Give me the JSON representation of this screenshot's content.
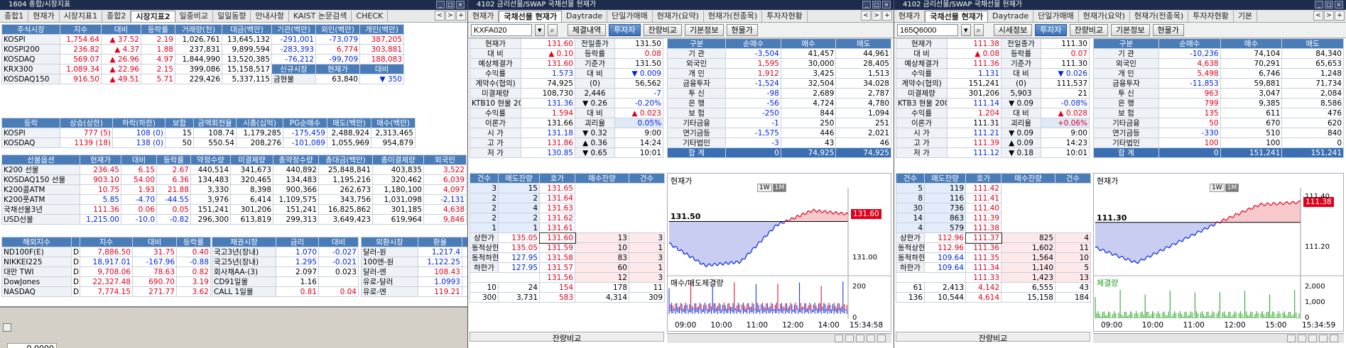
{
  "w1": {
    "title": "1604 종합/시장지표",
    "tabs": [
      "종합1",
      "현재가",
      "시장지표1",
      "종합2",
      "시장지표2",
      "일중비교",
      "일일동향",
      "안내사항",
      "KAIST 논문검색",
      "CHECK"
    ],
    "active": 4,
    "stock_hdr": [
      "주식시장",
      "지수",
      "대비",
      "등락률",
      "거래량(천)",
      "대금(백만)",
      "기관(백만)",
      "외인(백만)",
      "개인(백만)"
    ],
    "stock_rows": [
      {
        "n": "KOSPI",
        "v": [
          "1,754.64",
          "▲ 37.52",
          "2.19",
          "1,026,761",
          "13,645,132",
          "-291,001",
          "-73,079",
          "387,205"
        ],
        "c": [
          "r",
          "r",
          "r",
          "",
          "",
          "b",
          "b",
          "r"
        ]
      },
      {
        "n": "KOSPI200",
        "v": [
          "236.82",
          "▲ 4.37",
          "1.88",
          "237,831",
          "9,899,594",
          "-283,393",
          "6,774",
          "303,881"
        ],
        "c": [
          "r",
          "r",
          "r",
          "",
          "",
          "b",
          "r",
          "r"
        ]
      },
      {
        "n": "KOSDAQ",
        "v": [
          "569.07",
          "▲ 26.96",
          "4.97",
          "1,844,990",
          "13,520,385",
          "-76,212",
          "-99,709",
          "188,083"
        ],
        "c": [
          "r",
          "r",
          "r",
          "",
          "",
          "b",
          "b",
          "r"
        ]
      },
      {
        "n": "KRX300",
        "v": [
          "1,089.34",
          "▲ 22.96",
          "2.15",
          "399,086",
          "15,158,517",
          "신규시장",
          "현재가",
          "대비"
        ],
        "c": [
          "r",
          "r",
          "r",
          "",
          "",
          "h",
          "h",
          "h"
        ]
      },
      {
        "n": "KOSDAQ150",
        "v": [
          "916.50",
          "▲ 49.51",
          "5.71",
          "229,426",
          "5,337,115",
          "금현물",
          "63,840",
          "▼ 350"
        ],
        "c": [
          "r",
          "r",
          "r",
          "",
          "",
          "l",
          "",
          "b"
        ]
      }
    ],
    "adv_hdr": [
      "등락",
      "상승(상한)",
      "하락(하한)",
      "보합",
      "금액회전율",
      "시총(십억)",
      "PG순매수",
      "매도(백만)",
      "매수(백만)"
    ],
    "adv_rows": [
      {
        "n": "KOSPI",
        "v": [
          "777 (5)",
          "108 (0)",
          "15",
          "108.74",
          "1,179,285",
          "-175,459",
          "2,488,924",
          "2,313,465"
        ],
        "c": [
          "r",
          "b",
          "",
          "",
          "",
          "b",
          "",
          ""
        ]
      },
      {
        "n": "KOSDAQ",
        "v": [
          "1139 (18)",
          "138 (0)",
          "50",
          "550.54",
          "208,276",
          "-101,089",
          "1,055,969",
          "954,879"
        ],
        "c": [
          "r",
          "b",
          "",
          "",
          "",
          "b",
          "",
          ""
        ]
      }
    ],
    "fut_hdr": [
      "선물옵션",
      "현재가",
      "대비",
      "등락률",
      "약정수량",
      "미결제량",
      "총약정수량",
      "총대금(백만)",
      "총미결제량",
      "외국인"
    ],
    "fut_rows": [
      {
        "n": "K200 선물",
        "v": [
          "236.45",
          "6.15",
          "2.67",
          "440,514",
          "341,673",
          "440,892",
          "25,848,841",
          "403,835",
          "3,522"
        ],
        "c": [
          "r",
          "r",
          "r",
          "",
          "",
          "",
          "",
          "",
          "r"
        ]
      },
      {
        "n": "KOSDAQ150 선물",
        "v": [
          "903.10",
          "54.00",
          "6.36",
          "134,483",
          "320,465",
          "134,483",
          "1,195,216",
          "320,462",
          "6,039"
        ],
        "c": [
          "r",
          "r",
          "r",
          "",
          "",
          "",
          "",
          "",
          "r"
        ]
      },
      {
        "n": "K200콜ATM",
        "v": [
          "10.75",
          "1.93",
          "21.88",
          "3,330",
          "8,398",
          "900,366",
          "262,673",
          "1,180,100",
          "4,097"
        ],
        "c": [
          "r",
          "r",
          "r",
          "",
          "",
          "",
          "",
          "",
          "r"
        ]
      },
      {
        "n": "K200풋ATM",
        "v": [
          "5.85",
          "-4.70",
          "-44.55",
          "3,976",
          "6,414",
          "1,109,575",
          "343,756",
          "1,031,098",
          "-2,131"
        ],
        "c": [
          "b",
          "b",
          "b",
          "",
          "",
          "",
          "",
          "",
          "b"
        ]
      },
      {
        "n": "국채선물3년",
        "v": [
          "111.36",
          "0.06",
          "0.05",
          "151,241",
          "301,206",
          "151,241",
          "16,825,862",
          "301,185",
          "4,638"
        ],
        "c": [
          "r",
          "r",
          "r",
          "",
          "",
          "",
          "",
          "",
          "r"
        ]
      },
      {
        "n": "USD선물",
        "v": [
          "1,215.00",
          "-10.0",
          "-0.82",
          "296,300",
          "613,819",
          "299,313",
          "3,649,423",
          "619,964",
          "9,846"
        ],
        "c": [
          "b",
          "b",
          "b",
          "",
          "",
          "",
          "",
          "",
          "r"
        ]
      }
    ],
    "ovs_hdr": [
      "해외지수",
      "",
      "지수",
      "대비",
      "등락률"
    ],
    "ovs_rows": [
      {
        "n": "ND100F(E)",
        "d": "D",
        "v": [
          "7,886.50",
          "31.75",
          "0.40"
        ],
        "c": [
          "r",
          "r",
          "r"
        ]
      },
      {
        "n": "NIKKEI225",
        "d": "D",
        "v": [
          "18,917.01",
          "-167.96",
          "-0.88"
        ],
        "c": [
          "b",
          "b",
          "b"
        ]
      },
      {
        "n": "대만 TWI",
        "d": "D",
        "v": [
          "9,708.06",
          "78.63",
          "0.82"
        ],
        "c": [
          "r",
          "r",
          "r"
        ]
      },
      {
        "n": "DowJones",
        "d": "D",
        "v": [
          "22,327.48",
          "690.70",
          "3.19"
        ],
        "c": [
          "r",
          "r",
          "r"
        ]
      },
      {
        "n": "NASDAQ",
        "d": "D",
        "v": [
          "7,774.15",
          "271.77",
          "3.62"
        ],
        "c": [
          "r",
          "r",
          "r"
        ]
      }
    ],
    "bond_hdr": [
      "채권시장",
      "금리",
      "대비"
    ],
    "bond_rows": [
      {
        "n": "국고3년(장내)",
        "v": [
          "1.070",
          "-0.027"
        ],
        "c": [
          "b",
          "b"
        ]
      },
      {
        "n": "국고5년(장내)",
        "v": [
          "1.295",
          "-0.021"
        ],
        "c": [
          "b",
          "b"
        ]
      },
      {
        "n": "회사채AA-(3)",
        "v": [
          "2.097",
          "0.023"
        ],
        "c": [
          "",
          ""
        ]
      },
      {
        "n": "CD91일물",
        "v": [
          "1.16",
          ""
        ],
        "c": [
          "",
          ""
        ]
      },
      {
        "n": "CALL 1일물",
        "v": [
          "0.81",
          "0.04"
        ],
        "c": [
          "r",
          "r"
        ]
      }
    ],
    "fx_hdr": [
      "외환시장",
      "환율",
      "대비"
    ],
    "fx_rows": [
      {
        "n": "달러-원",
        "v": [
          "1,217.4",
          "-7.0"
        ],
        "c": [
          "b",
          "b"
        ]
      },
      {
        "n": "100엔-원",
        "v": [
          "1,122.25",
          "-12.29"
        ],
        "c": [
          "b",
          "b"
        ]
      },
      {
        "n": "달러-엔",
        "v": [
          "108.43",
          "0.52"
        ],
        "c": [
          "r",
          "r"
        ]
      },
      {
        "n": "유로-달러",
        "v": [
          "1.0993",
          "-0.0047"
        ],
        "c": [
          "b",
          "b"
        ]
      },
      {
        "n": "유로-엔",
        "v": [
          "119.21",
          "0.08"
        ],
        "c": [
          "r",
          "r"
        ]
      }
    ],
    "below_value": "0.0000"
  },
  "panels": [
    {
      "title": "4102 금리선물/SWAP 국채선물 현재가",
      "tabs": [
        "현재가",
        "국채선물 현재가",
        "Daytrade",
        "단일가매매",
        "현재가(요약)",
        "현재가(전종목)",
        "투자자현황"
      ],
      "active": 1,
      "code": "KXFA020",
      "buttons": [
        "체결내역",
        "투자자",
        "잔량비교",
        "기본정보",
        "현물가"
      ],
      "btn_on": 1,
      "info": [
        [
          "현재가",
          "131.60",
          "r",
          "전일종가",
          "131.50",
          ""
        ],
        [
          "대 비",
          "▲ 0.10",
          "r",
          "등락률",
          "0.08",
          "r"
        ],
        [
          "예상체결가",
          "131.60",
          "r",
          "기준가",
          "131.50",
          ""
        ],
        [
          "수익률",
          "1.573",
          "b",
          "대 비",
          "▼ 0.009",
          "b"
        ],
        [
          "계약수(협의)",
          "74,925",
          "",
          "(0)",
          "56,562",
          ""
        ],
        [
          "미결제량",
          "108,730",
          "",
          "2,446",
          "-7",
          "b"
        ],
        [
          "KTB10 현물 20",
          "131.36",
          "b",
          "▼ 0.26",
          "-0.20%",
          "b"
        ],
        [
          "수익률",
          "1.594",
          "r",
          "대 비",
          "▲ 0.023",
          "r"
        ],
        [
          "이론가",
          "131.66",
          "",
          "괴리율",
          "0.05%",
          "b"
        ],
        [
          "시 가",
          "131.18",
          "b",
          "▼ 0.32",
          "9:00",
          ""
        ],
        [
          "고 가",
          "131.86",
          "r",
          "▲ 0.36",
          "14:24",
          ""
        ],
        [
          "저 가",
          "130.85",
          "b",
          "▼ 0.65",
          "10:01",
          ""
        ]
      ],
      "inv_hdr": [
        "구분",
        "순매수",
        "매수",
        "매도"
      ],
      "inv": [
        [
          "기 관",
          "-3,504",
          "41,457",
          "44,961"
        ],
        [
          "외국인",
          "1,595",
          "30,000",
          "28,405"
        ],
        [
          "개 인",
          "1,912",
          "3,425",
          "1,513"
        ],
        [
          "금융투자",
          "-1,524",
          "32,504",
          "34,028"
        ],
        [
          "투 신",
          "-98",
          "2,689",
          "2,787"
        ],
        [
          "은 행",
          "-56",
          "4,724",
          "4,780"
        ],
        [
          "보 험",
          "-250",
          "844",
          "1,094"
        ],
        [
          "기타금융",
          "-1",
          "250",
          "251"
        ],
        [
          "연기금등",
          "-1,575",
          "446",
          "2,021"
        ],
        [
          "기타법인",
          "-3",
          "43",
          "46"
        ],
        [
          "합 계",
          "0",
          "74,925",
          "74,925"
        ]
      ],
      "ob_hdr": [
        "건수",
        "매도잔량",
        "호가",
        "매수잔량",
        "건수"
      ],
      "asks": [
        [
          "3",
          "15",
          "131.65"
        ],
        [
          "2",
          "2",
          "131.64"
        ],
        [
          "2",
          "4",
          "131.63"
        ],
        [
          "2",
          "2",
          "131.62"
        ],
        [
          "1",
          "1",
          "131.61"
        ]
      ],
      "bids": [
        [
          "131.60",
          "13",
          "3"
        ],
        [
          "131.59",
          "10",
          "1"
        ],
        [
          "131.58",
          "83",
          "3"
        ],
        [
          "131.57",
          "60",
          "1"
        ],
        [
          "131.56",
          "12",
          "3"
        ]
      ],
      "limits": [
        [
          "상한가",
          "135.05"
        ],
        [
          "동적상한",
          "135.05"
        ],
        [
          "동적하한",
          "127.95"
        ],
        [
          "하한가",
          "127.95"
        ]
      ],
      "ob_tot1": [
        "10",
        "24",
        "154",
        "178",
        "11"
      ],
      "ob_tot2": [
        "300",
        "3,731",
        "583",
        "4,314",
        "309"
      ],
      "ob_footer": "잔량비교",
      "chart_title": "현재가",
      "ref_label": "131.50",
      "cur_tag": "131.60",
      "y_ticks": [
        "131.00"
      ],
      "vol_title": "매수/매도체결량",
      "vol_ticks": [
        "200",
        "0"
      ],
      "x_ticks": [
        "09:00",
        "10:00",
        "11:00",
        "12:00",
        "14:00"
      ],
      "clock": "15:34:58",
      "chart_btn1": "1W",
      "chart_btn2": "1M",
      "chart_data": {
        "type": "line",
        "title": "현재가",
        "x": [
          "09:00",
          "10:00",
          "11:00",
          "12:00",
          "14:00",
          "15:34"
        ],
        "series": [
          {
            "name": "현재가",
            "values": [
              131.2,
              130.9,
              130.95,
              131.45,
              131.65,
              131.6
            ]
          }
        ],
        "reference": 131.5,
        "ylim": [
          130.8,
          131.9
        ]
      }
    },
    {
      "title": "4102 금리선물/SWAP 국채선물 현재가",
      "tabs": [
        "현재가",
        "국채선물 현재가",
        "Daytrade",
        "단일가매매",
        "현재가(요약)",
        "현재가(전종목)",
        "투자자현황",
        "기본"
      ],
      "active": 1,
      "code": "165Q6000",
      "buttons": [
        "시세정보",
        "투자자",
        "잔량비교",
        "기본정보",
        "현물가"
      ],
      "btn_on": 1,
      "info": [
        [
          "현재가",
          "111.38",
          "r",
          "전일종가",
          "111.30",
          ""
        ],
        [
          "대 비",
          "▲ 0.08",
          "r",
          "등락률",
          "0.07",
          "r"
        ],
        [
          "예상체결가",
          "111.36",
          "r",
          "기준가",
          "111.30",
          ""
        ],
        [
          "수익률",
          "1.131",
          "b",
          "대 비",
          "▼ 0.026",
          "b"
        ],
        [
          "계약수(협의)",
          "151,241",
          "",
          "(0)",
          "111,537",
          ""
        ],
        [
          "미결제량",
          "301,206",
          "",
          "5,903",
          "21",
          ""
        ],
        [
          "KTB3 현물 200",
          "111.14",
          "b",
          "▼ 0.09",
          "-0.08%",
          "b"
        ],
        [
          "수익률",
          "1.204",
          "r",
          "대 비",
          "▲ 0.028",
          "r"
        ],
        [
          "이론가",
          "111.31",
          "",
          "괴리율",
          "+0.06%",
          "r"
        ],
        [
          "시 가",
          "111.21",
          "b",
          "▼ 0.09",
          "9:00",
          ""
        ],
        [
          "고 가",
          "111.39",
          "r",
          "▲ 0.09",
          "14:23",
          ""
        ],
        [
          "저 가",
          "111.12",
          "b",
          "▼ 0.18",
          "10:01",
          ""
        ]
      ],
      "inv_hdr": [
        "구분",
        "순매수",
        "매수",
        "매도"
      ],
      "inv": [
        [
          "기 관",
          "-10,236",
          "74,104",
          "84,340"
        ],
        [
          "외국인",
          "4,638",
          "70,291",
          "65,653"
        ],
        [
          "개 인",
          "5,498",
          "6,746",
          "1,248"
        ],
        [
          "금융투자",
          "-11,853",
          "59,881",
          "71,734"
        ],
        [
          "투 신",
          "963",
          "3,047",
          "2,084"
        ],
        [
          "은 행",
          "799",
          "9,385",
          "8,586"
        ],
        [
          "보 험",
          "135",
          "611",
          "476"
        ],
        [
          "기타금융",
          "50",
          "670",
          "620"
        ],
        [
          "연기금등",
          "-330",
          "510",
          "840"
        ],
        [
          "기타법인",
          "100",
          "100",
          "0"
        ],
        [
          "합 계",
          "0",
          "151,241",
          "151,241"
        ]
      ],
      "ob_hdr": [
        "건수",
        "매도잔량",
        "호가",
        "매수잔량",
        "건수"
      ],
      "asks": [
        [
          "5",
          "119",
          "111.42"
        ],
        [
          "8",
          "116",
          "111.41"
        ],
        [
          "30",
          "736",
          "111.40"
        ],
        [
          "14",
          "863",
          "111.39"
        ],
        [
          "4",
          "579",
          "111.38"
        ]
      ],
      "bids": [
        [
          "111.37",
          "825",
          "4"
        ],
        [
          "111.36",
          "1,602",
          "11"
        ],
        [
          "111.35",
          "1,564",
          "10"
        ],
        [
          "111.34",
          "1,140",
          "5"
        ],
        [
          "111.33",
          "1,423",
          "13"
        ]
      ],
      "limits": [
        [
          "상한가",
          "112.96"
        ],
        [
          "동적상한",
          "112.96"
        ],
        [
          "동적하한",
          "109.64"
        ],
        [
          "하한가",
          "109.64"
        ]
      ],
      "ob_tot1": [
        "61",
        "2,413",
        "4,142",
        "6,555",
        "43"
      ],
      "ob_tot2": [
        "136",
        "10,544",
        "4,614",
        "15,158",
        "184"
      ],
      "ob_footer": "잔량비교",
      "chart_title": "현재가",
      "ref_label": "111.30",
      "cur_tag": "111.38",
      "y_ticks": [
        "111.40",
        "111.20"
      ],
      "vol_title": "체결량",
      "vol_ticks": [
        "2,000",
        "1,000",
        "0"
      ],
      "x_ticks": [
        "09:00",
        "10:00",
        "11:00",
        "12:00",
        "15:00"
      ],
      "clock": "15:34:59",
      "chart_btn1": "1W",
      "chart_btn2": "1M",
      "chart_data": {
        "type": "line",
        "title": "현재가",
        "x": [
          "09:00",
          "10:00",
          "11:00",
          "12:00",
          "15:00",
          "15:34"
        ],
        "series": [
          {
            "name": "현재가",
            "values": [
              111.2,
              111.14,
              111.22,
              111.3,
              111.37,
              111.38
            ]
          }
        ],
        "reference": 111.3,
        "ylim": [
          111.1,
          111.42
        ]
      }
    }
  ]
}
